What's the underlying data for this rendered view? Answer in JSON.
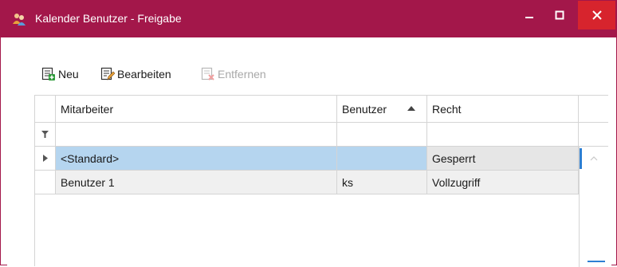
{
  "window": {
    "title": "Kalender Benutzer - Freigabe",
    "accent_color": "#a3174a",
    "close_color": "#d7242d",
    "icons": {
      "app": "users-share-icon",
      "minimize": "minimize-icon",
      "maximize": "maximize-icon",
      "close": "close-icon"
    }
  },
  "toolbar": {
    "new_label": "Neu",
    "edit_label": "Bearbeiten",
    "remove_label": "Entfernen",
    "remove_disabled": true,
    "icons": {
      "new": "add-record-icon",
      "edit": "edit-record-icon",
      "remove": "delete-record-icon"
    }
  },
  "grid": {
    "columns": [
      {
        "label": "Mitarbeiter"
      },
      {
        "label": "Benutzer",
        "sorted": "ascending"
      },
      {
        "label": "Recht"
      }
    ],
    "filter_icon": "filter-icon",
    "rows": [
      {
        "mitarbeiter": "<Standard>",
        "benutzer": "",
        "recht": "Gesperrt",
        "selected": true
      },
      {
        "mitarbeiter": "Benutzer 1",
        "benutzer": "ks",
        "recht": "Vollzugriff",
        "selected": false
      }
    ],
    "selection_color": "#b5d5ef"
  }
}
